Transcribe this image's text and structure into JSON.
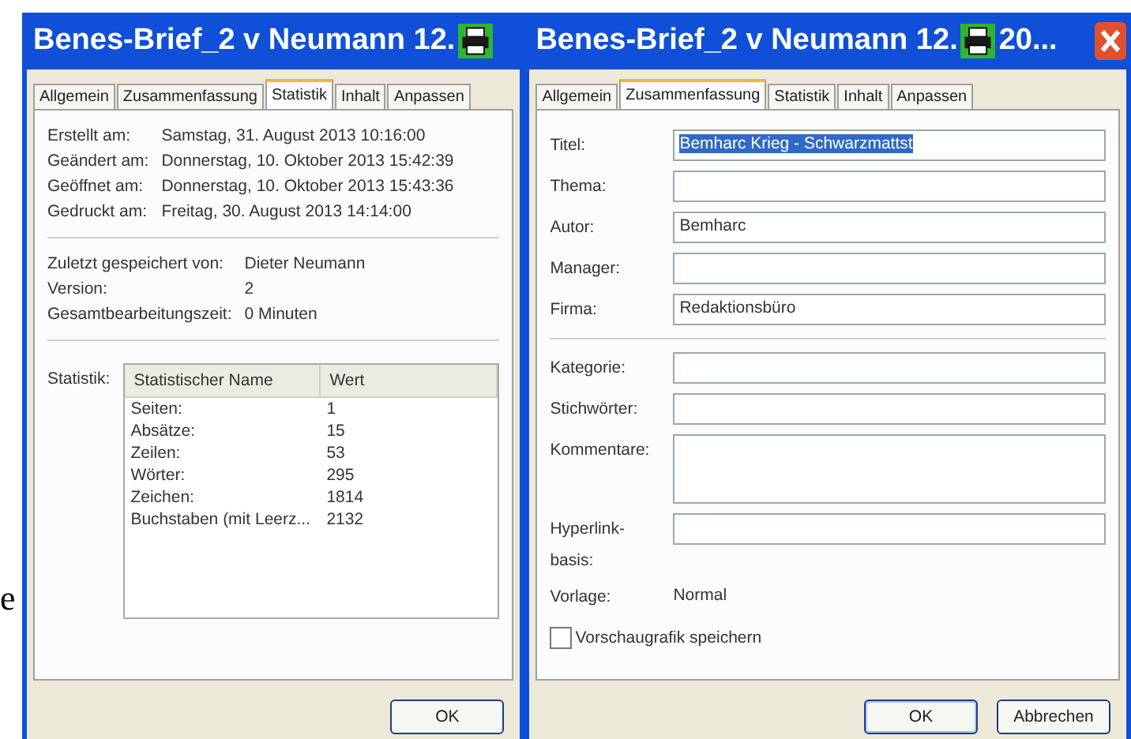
{
  "background_text": "e",
  "left_window": {
    "title": "Benes-Brief_2 v Neumann 12.",
    "tabs": [
      {
        "label": "Allgemein",
        "selected": false
      },
      {
        "label": "Zusammenfassung",
        "selected": false
      },
      {
        "label": "Statistik",
        "selected": true
      },
      {
        "label": "Inhalt",
        "selected": false
      },
      {
        "label": "Anpassen",
        "selected": false
      }
    ],
    "dates": [
      {
        "label": "Erstellt am:",
        "value": "Samstag, 31. August 2013 10:16:00"
      },
      {
        "label": "Geändert am:",
        "value": "Donnerstag, 10. Oktober 2013 15:42:39"
      },
      {
        "label": "Geöffnet am:",
        "value": "Donnerstag, 10. Oktober 2013 15:43:36"
      },
      {
        "label": "Gedruckt am:",
        "value": "Freitag, 30. August 2013 14:14:00"
      }
    ],
    "info": [
      {
        "label": "Zuletzt gespeichert von:",
        "value": "Dieter Neumann"
      },
      {
        "label": "Version:",
        "value": "2"
      },
      {
        "label": "Gesamtbearbeitungszeit:",
        "value": "0 Minuten"
      }
    ],
    "statistics_label": "Statistik:",
    "table": {
      "columns": [
        "Statistischer Name",
        "Wert"
      ],
      "rows": [
        [
          "Seiten:",
          "1"
        ],
        [
          "Absätze:",
          "15"
        ],
        [
          "Zeilen:",
          "53"
        ],
        [
          "Wörter:",
          "295"
        ],
        [
          "Zeichen:",
          "1814"
        ],
        [
          "Buchstaben (mit Leerz...",
          "2132"
        ]
      ]
    },
    "buttons": [
      "OK"
    ]
  },
  "right_window": {
    "title": "Benes-Brief_2 v Neumann 12.",
    "title_tail": "20...",
    "tabs": [
      {
        "label": "Allgemein",
        "selected": false
      },
      {
        "label": "Zusammenfassung",
        "selected": true
      },
      {
        "label": "Statistik",
        "selected": false
      },
      {
        "label": "Inhalt",
        "selected": false
      },
      {
        "label": "Anpassen",
        "selected": false
      }
    ],
    "fields": [
      {
        "label": "Titel:",
        "value": "Bemharc Krieg - Schwarzmattst",
        "text_selected": true,
        "kind": "line"
      },
      {
        "label": "Thema:",
        "kind": "line"
      },
      {
        "label": "Autor:",
        "value": "Bemharc",
        "text_selected": false,
        "kind": "line"
      },
      {
        "label": "Manager:",
        "kind": "line"
      },
      {
        "label": "Firma:",
        "value": "Redaktionsbüro",
        "text_selected": false,
        "kind": "line"
      },
      {
        "kind": "divider"
      },
      {
        "label": "Kategorie:",
        "kind": "line"
      },
      {
        "label": "Stichwörter:",
        "kind": "line"
      },
      {
        "label": "Kommentare:",
        "kind": "area"
      },
      {
        "label": "Hyperlink-basis:",
        "kind": "line"
      }
    ],
    "template": {
      "label": "Vorlage:",
      "value": "Normal"
    },
    "checkbox": {
      "label": "Vorschaugrafik speichern",
      "checked": false
    },
    "buttons": [
      "OK",
      "Abbrechen"
    ]
  }
}
